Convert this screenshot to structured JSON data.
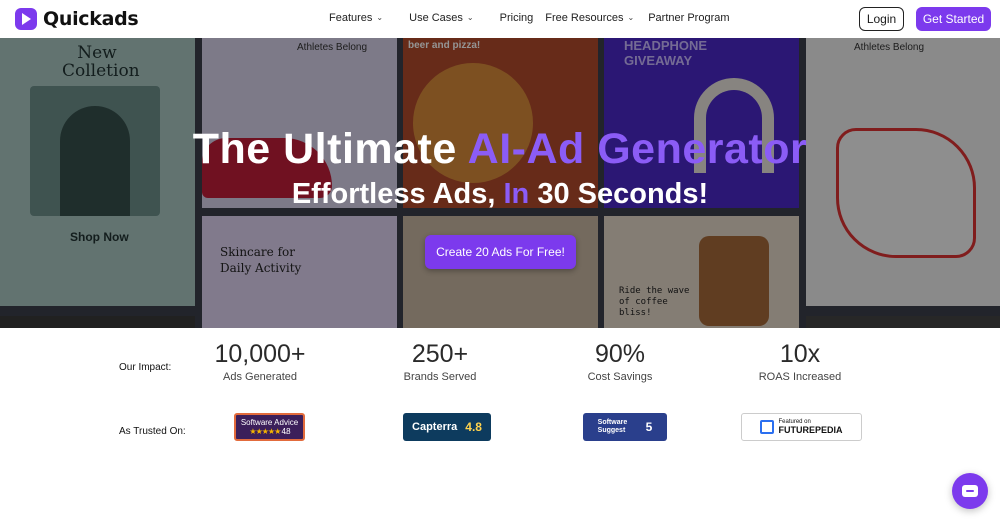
{
  "brand": {
    "name": "Quickads",
    "accent_color": "#7c3aed"
  },
  "nav": {
    "items": [
      {
        "label": "Features",
        "has_dropdown": true
      },
      {
        "label": "Use Cases",
        "has_dropdown": true
      },
      {
        "label": "Pricing",
        "has_dropdown": false
      },
      {
        "label": "Free Resources",
        "has_dropdown": true
      },
      {
        "label": "Partner Program",
        "has_dropdown": false
      }
    ],
    "login_label": "Login",
    "cta_label": "Get Started"
  },
  "hero": {
    "title_prefix": "The Ultimate",
    "title_accent": "AI-Ad Generator",
    "subtitle_prefix": "Effortless Ads,",
    "subtitle_accent": "In",
    "subtitle_suffix": "30 Seconds!",
    "cta_label": "Create 20 Ads For Free!",
    "tiles": {
      "t1_text": "New Colletion",
      "t1_shop": "Shop Now",
      "t2_text": "Athletes Belong",
      "t3_text": "beer and pizza!",
      "t4_text": "HEADPHONE GIVEAWAY",
      "t5_text": "Athletes Belong",
      "t6_text": "Skincare for Daily Activity",
      "t8_text": "Ride the wave of coffee bliss!"
    }
  },
  "impact": {
    "label": "Our Impact:",
    "stats": [
      {
        "value": "10,000+",
        "caption": "Ads Generated"
      },
      {
        "value": "250+",
        "caption": "Brands Served"
      },
      {
        "value": "90%",
        "caption": "Cost Savings"
      },
      {
        "value": "10x",
        "caption": "ROAS Increased"
      }
    ]
  },
  "trusted": {
    "label": "As Trusted On:",
    "badges": [
      {
        "name": "Software Advice",
        "rating": "4.8"
      },
      {
        "name": "Capterra",
        "rating": "4.8"
      },
      {
        "name": "Software Suggest",
        "rating": "5"
      },
      {
        "name": "FUTUREPEDIA",
        "prefix": "Featured on"
      }
    ]
  },
  "chat": {
    "icon": "chat-icon"
  }
}
